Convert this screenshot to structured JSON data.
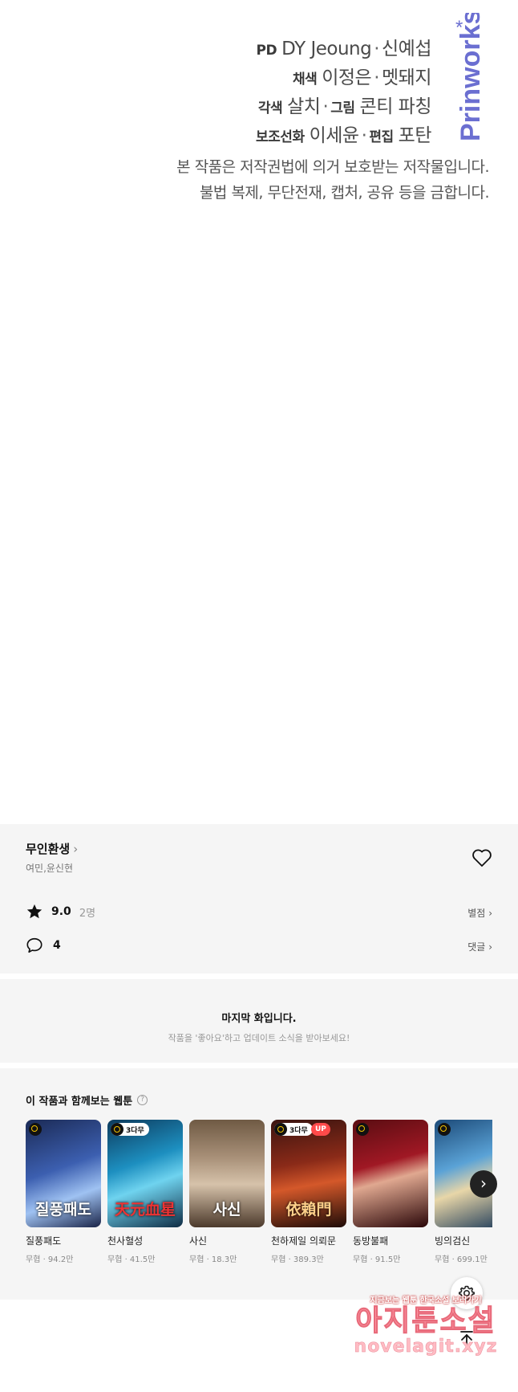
{
  "credits": {
    "lines": [
      {
        "role": "PD",
        "text": "DY Jeoung",
        "sep": "·",
        "text2": "신예섭"
      },
      {
        "role": "채색",
        "text": "이정은",
        "sep": "·",
        "text2": "멧돼지"
      },
      {
        "role": "각색",
        "text": "살치",
        "sep": "·",
        "role2": "그림",
        "text2": "콘티 파칭"
      },
      {
        "role": "보조선화",
        "text": "이세윤",
        "sep": "·",
        "role2": "편집",
        "text2": "포탄"
      }
    ],
    "logo": "Prinworks",
    "notice": [
      "본 작품은 저작권법에 의거 보호받는 저작물입니다.",
      "불법 복제, 무단전재, 캡처, 공유 등을 금합니다."
    ]
  },
  "work": {
    "title": "무인환생",
    "authors": "여민,윤신현",
    "rating": "9.0",
    "rating_count": "2명",
    "rating_link": "별점",
    "comment_count": "4",
    "comment_link": "댓글"
  },
  "last_episode": {
    "heading": "마지막 화입니다.",
    "sub": "작품을 '좋아요'하고 업데이트 소식을 받아보세요!"
  },
  "recommend": {
    "title": "이 작품과 함께보는 웹툰",
    "help": "?",
    "items": [
      {
        "name": "질풍패도",
        "meta": "무협 · 94.2만",
        "badge": "",
        "up": "",
        "art": "질풍패도"
      },
      {
        "name": "천사혈성",
        "meta": "무협 · 41.5만",
        "badge": "3다무",
        "up": "",
        "art": "天元血星"
      },
      {
        "name": "사신",
        "meta": "무협 · 18.3만",
        "badge": "",
        "up": "",
        "art": "사신"
      },
      {
        "name": "천하제일 의뢰문",
        "meta": "무협 · 389.3만",
        "badge": "3다무",
        "up": "UP",
        "art": "依賴門"
      },
      {
        "name": "동방불패",
        "meta": "무협 · 91.5만",
        "badge": "",
        "up": "",
        "art": ""
      },
      {
        "name": "빙의검신",
        "meta": "무협 · 699.1만",
        "badge": "",
        "up": "",
        "art": ""
      }
    ],
    "next_icon": "chevron-right-icon"
  },
  "watermark": {
    "top": "지금보는 웹툰 한국소설 보러가기",
    "mid": "아지툰소설",
    "bot": "novelagit.xyz"
  },
  "colors": {
    "logo": "#6b6fd1",
    "badge_up": "#ff4a4a",
    "clock_ring": "#f2c200"
  }
}
